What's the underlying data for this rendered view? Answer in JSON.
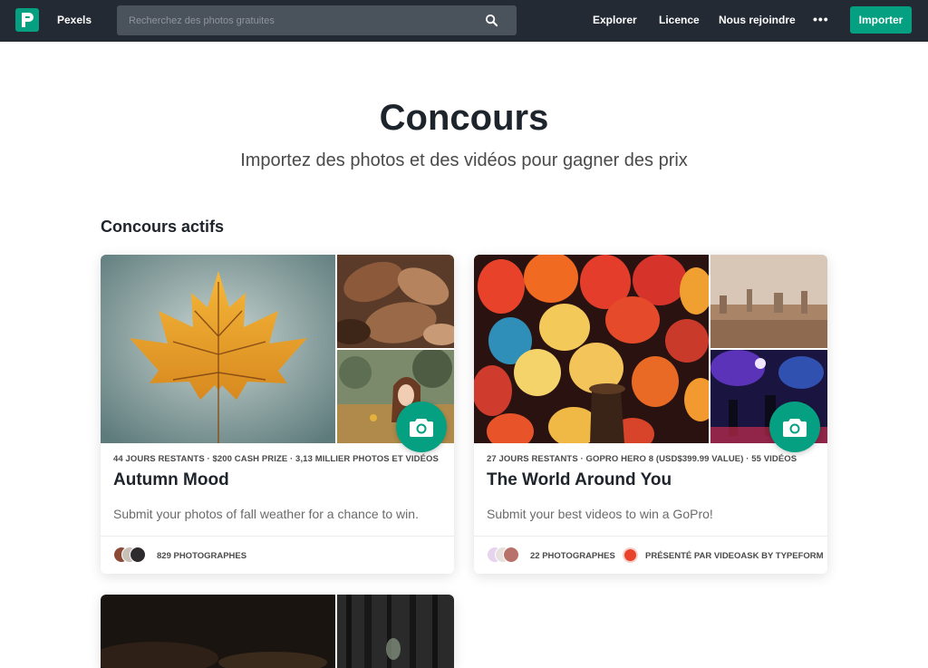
{
  "nav": {
    "brand": "Pexels",
    "search_placeholder": "Recherchez des photos gratuites",
    "links": [
      "Explorer",
      "Licence",
      "Nous rejoindre"
    ],
    "more": "•••",
    "import_label": "Importer"
  },
  "header": {
    "title": "Concours",
    "subtitle": "Importez des photos et des vidéos pour gagner des prix"
  },
  "section_title": "Concours actifs",
  "contests": [
    {
      "meta": "44 JOURS RESTANTS · $200 CASH PRIZE · 3,13 MILLIER PHOTOS ET VIDÉOS",
      "title": "Autumn Mood",
      "description": "Submit your photos of fall weather for a chance to win.",
      "participants": "829 PHOTOGRAPHES"
    },
    {
      "meta": "27 JOURS RESTANTS · GOPRO HERO 8 (USD$399.99 VALUE) · 55 VIDÉOS",
      "title": "The World Around You",
      "description": "Submit your best videos to win a GoPro!",
      "participants": "22 PHOTOGRAPHES",
      "sponsor": "PRÉSENTÉ PAR VIDEOASK BY TYPEFORM"
    }
  ],
  "colors": {
    "brand_green": "#05a081",
    "nav_bg": "#232a34"
  }
}
